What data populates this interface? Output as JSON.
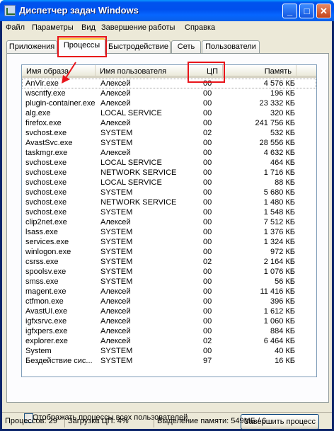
{
  "window": {
    "title": "Диспетчер задач Windows"
  },
  "titlebar_buttons": {
    "minimize": "_",
    "maximize": "□",
    "close": "✕"
  },
  "menu": [
    "Файл",
    "Параметры",
    "Вид",
    "Завершение работы",
    "Справка"
  ],
  "tabs": [
    "Приложения",
    "Процессы",
    "Быстродействие",
    "Сеть",
    "Пользователи"
  ],
  "active_tab": "Процессы",
  "columns": [
    "Имя образа",
    "Имя пользователя",
    "ЦП",
    "Память"
  ],
  "processes": [
    {
      "name": "AnVir.exe",
      "user": "Алексей",
      "cpu": "00",
      "mem": "4 576 КБ"
    },
    {
      "name": "wscntfy.exe",
      "user": "Алексей",
      "cpu": "00",
      "mem": "196 КБ"
    },
    {
      "name": "plugin-container.exe",
      "user": "Алексей",
      "cpu": "00",
      "mem": "23 332 КБ"
    },
    {
      "name": "alg.exe",
      "user": "LOCAL SERVICE",
      "cpu": "00",
      "mem": "320 КБ"
    },
    {
      "name": "firefox.exe",
      "user": "Алексей",
      "cpu": "00",
      "mem": "241 756 КБ"
    },
    {
      "name": "svchost.exe",
      "user": "SYSTEM",
      "cpu": "02",
      "mem": "532 КБ"
    },
    {
      "name": "AvastSvc.exe",
      "user": "SYSTEM",
      "cpu": "00",
      "mem": "28 556 КБ"
    },
    {
      "name": "taskmgr.exe",
      "user": "Алексей",
      "cpu": "00",
      "mem": "4 632 КБ"
    },
    {
      "name": "svchost.exe",
      "user": "LOCAL SERVICE",
      "cpu": "00",
      "mem": "464 КБ"
    },
    {
      "name": "svchost.exe",
      "user": "NETWORK SERVICE",
      "cpu": "00",
      "mem": "1 716 КБ"
    },
    {
      "name": "svchost.exe",
      "user": "LOCAL SERVICE",
      "cpu": "00",
      "mem": "88 КБ"
    },
    {
      "name": "svchost.exe",
      "user": "SYSTEM",
      "cpu": "00",
      "mem": "5 680 КБ"
    },
    {
      "name": "svchost.exe",
      "user": "NETWORK SERVICE",
      "cpu": "00",
      "mem": "1 480 КБ"
    },
    {
      "name": "svchost.exe",
      "user": "SYSTEM",
      "cpu": "00",
      "mem": "1 548 КБ"
    },
    {
      "name": "clip2net.exe",
      "user": "Алексей",
      "cpu": "00",
      "mem": "7 512 КБ"
    },
    {
      "name": "lsass.exe",
      "user": "SYSTEM",
      "cpu": "00",
      "mem": "1 376 КБ"
    },
    {
      "name": "services.exe",
      "user": "SYSTEM",
      "cpu": "00",
      "mem": "1 324 КБ"
    },
    {
      "name": "winlogon.exe",
      "user": "SYSTEM",
      "cpu": "00",
      "mem": "972 КБ"
    },
    {
      "name": "csrss.exe",
      "user": "SYSTEM",
      "cpu": "02",
      "mem": "2 164 КБ"
    },
    {
      "name": "spoolsv.exe",
      "user": "SYSTEM",
      "cpu": "00",
      "mem": "1 076 КБ"
    },
    {
      "name": "smss.exe",
      "user": "SYSTEM",
      "cpu": "00",
      "mem": "56 КБ"
    },
    {
      "name": "magent.exe",
      "user": "Алексей",
      "cpu": "00",
      "mem": "11 416 КБ"
    },
    {
      "name": "ctfmon.exe",
      "user": "Алексей",
      "cpu": "00",
      "mem": "396 КБ"
    },
    {
      "name": "AvastUI.exe",
      "user": "Алексей",
      "cpu": "00",
      "mem": "1 612 КБ"
    },
    {
      "name": "igfxsrvc.exe",
      "user": "Алексей",
      "cpu": "00",
      "mem": "1 060 КБ"
    },
    {
      "name": "igfxpers.exe",
      "user": "Алексей",
      "cpu": "00",
      "mem": "884 КБ"
    },
    {
      "name": "explorer.exe",
      "user": "Алексей",
      "cpu": "02",
      "mem": "6 464 КБ"
    },
    {
      "name": "System",
      "user": "SYSTEM",
      "cpu": "00",
      "mem": "40 КБ"
    },
    {
      "name": "Бездействие сис...",
      "user": "SYSTEM",
      "cpu": "97",
      "mem": "16 КБ"
    }
  ],
  "show_all_label": "Отображать процессы всех пользователей",
  "end_process_label": "Завершить процесс",
  "status": {
    "processes": "Процессов: 29",
    "cpu": "Загрузка ЦП: 4%",
    "commit": "Выделение памяти: 549МБ / 6"
  },
  "colors": {
    "annotation": "#e8141a",
    "titlebar": "#0053ee",
    "frame": "#ece9d8"
  }
}
